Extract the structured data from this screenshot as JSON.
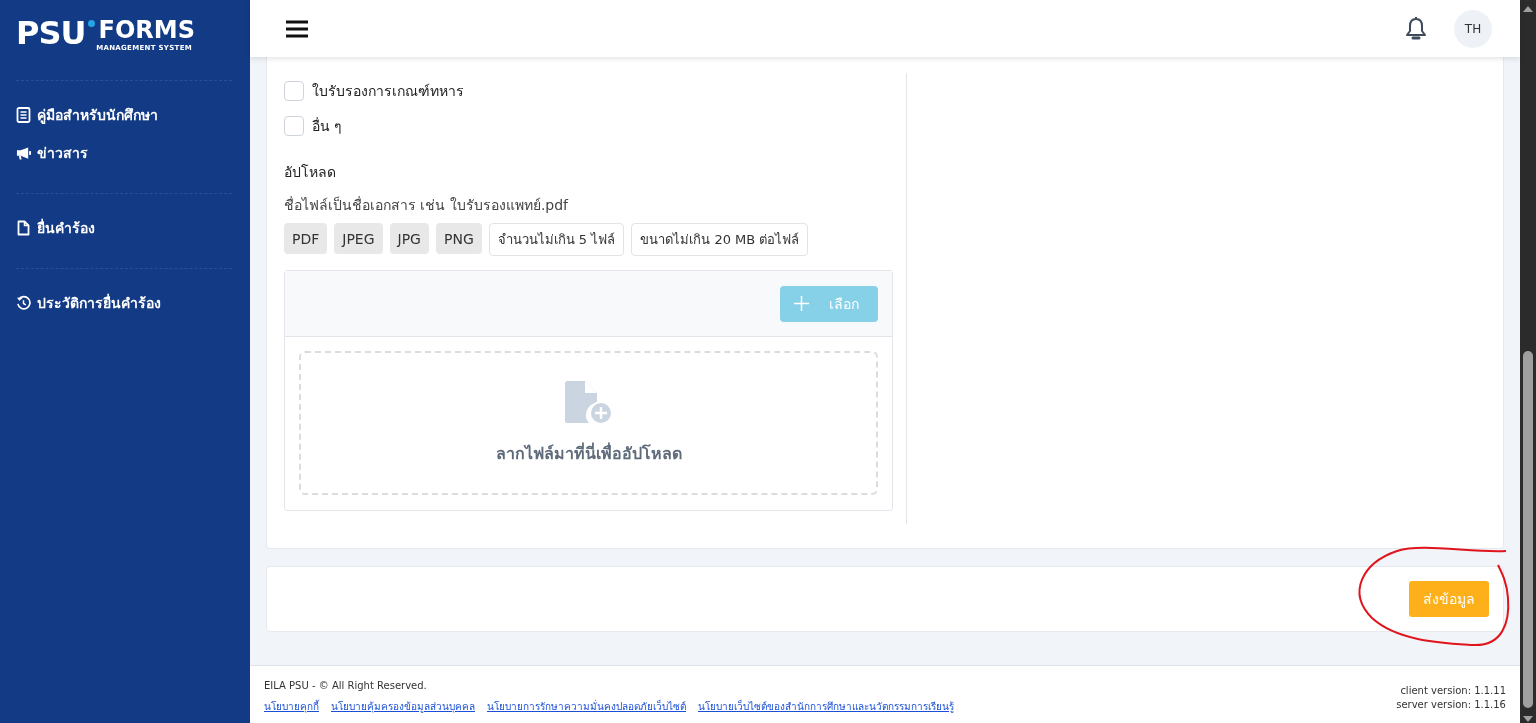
{
  "sidebar": {
    "logo": {
      "wordmark_left": "PSU",
      "wordmark_right": "FORMS",
      "subtitle": "MANAGEMENT SYSTEM"
    },
    "groups": [
      {
        "items": [
          {
            "label": "คู่มือสำหรับนักศึกษา"
          },
          {
            "label": "ข่าวสาร"
          }
        ]
      },
      {
        "items": [
          {
            "label": "ยื่นคำร้อง"
          }
        ]
      },
      {
        "items": [
          {
            "label": "ประวัติการยื่นคำร้อง"
          }
        ]
      }
    ]
  },
  "header": {
    "avatar": "TH"
  },
  "form": {
    "checkboxes": [
      {
        "label": "ใบรับรองการเกณฑ์ทหาร",
        "checked": false
      },
      {
        "label": "อื่น ๆ",
        "checked": false
      }
    ],
    "upload": {
      "label": "อัปโหลด",
      "hint": "ชื่อไฟล์เป็นชื่อเอกสาร เช่น ใบรับรองแพทย์.pdf",
      "file_types": [
        "PDF",
        "JPEG",
        "JPG",
        "PNG"
      ],
      "limits": [
        "จำนวนไม่เกิน 5 ไฟล์",
        "ขนาดไม่เกิน 20 MB ต่อไฟล์"
      ],
      "choose_button": {
        "label": "เลือก",
        "disabled": true
      },
      "dropzone_text": "ลากไฟล์มาที่นี่เพื่ออัปโหลด"
    }
  },
  "submit_button": "ส่งข้อมูล",
  "footer": {
    "copyright": "EILA PSU - © All Right Reserved.",
    "links": [
      "นโยบายคุกกี้",
      "นโยบายคุ้มครองข้อมูลส่วนบุคคล",
      "นโยบายการรักษาความมั่นคงปลอดภัยเว็บไซต์",
      "นโยบายเว็บไซต์ของสำนักการศึกษาและนวัตกรรมการเรียนรู้"
    ],
    "versions": [
      "client version: 1.1.11",
      "server version: 1.1.16"
    ]
  }
}
